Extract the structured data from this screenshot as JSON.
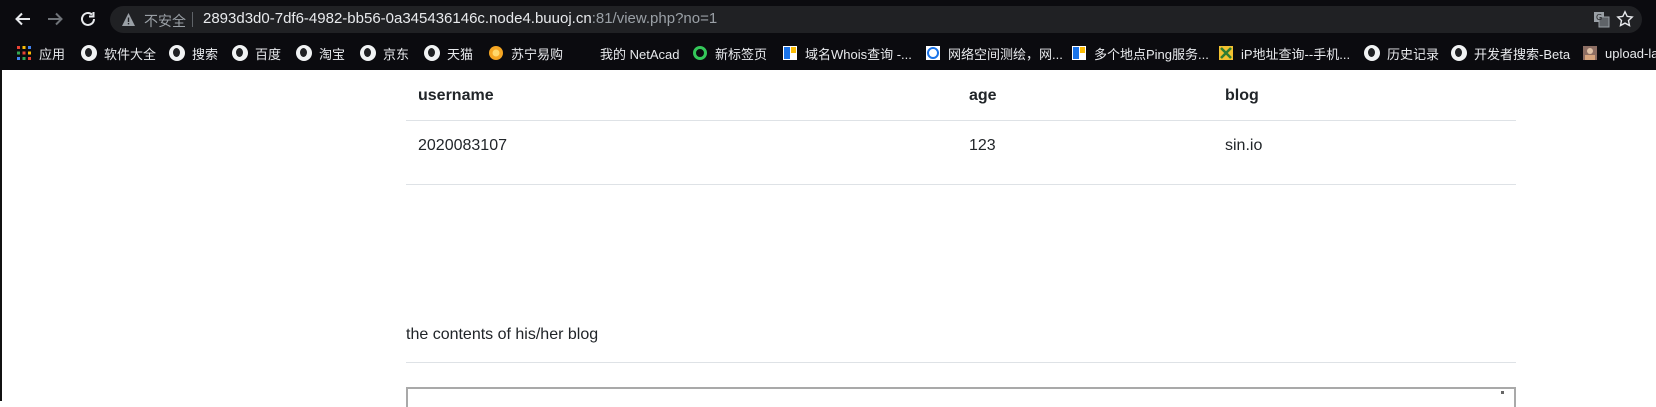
{
  "browser": {
    "security_label": "不安全",
    "url_host": "2893d3d0-7df6-4982-bb56-0a345436146c.node4.buuoj.cn",
    "url_path": ":81/view.php?no=1",
    "bookmarks": [
      {
        "label": "应用",
        "icon": "apps-grid-icon"
      },
      {
        "label": "软件大全",
        "icon": "globe-icon"
      },
      {
        "label": "搜索",
        "icon": "globe-icon"
      },
      {
        "label": "百度",
        "icon": "globe-icon"
      },
      {
        "label": "淘宝",
        "icon": "globe-icon"
      },
      {
        "label": "京东",
        "icon": "globe-icon"
      },
      {
        "label": "天猫",
        "icon": "globe-icon"
      },
      {
        "label": "苏宁易购",
        "icon": "suning-icon"
      },
      {
        "label": "我的 NetAcad",
        "icon": "netacad-icon"
      },
      {
        "label": "新标签页",
        "icon": "green-ring-icon"
      },
      {
        "label": "域名Whois查询 -...",
        "icon": "bookmark-blue-icon"
      },
      {
        "label": "网络空间测绘，网...",
        "icon": "shield-blue-icon"
      },
      {
        "label": "多个地点Ping服务...",
        "icon": "bookmark-blue-icon"
      },
      {
        "label": "iP地址查询--手机...",
        "icon": "ip-icon"
      },
      {
        "label": "历史记录",
        "icon": "globe-icon"
      },
      {
        "label": "开发者搜索-Beta",
        "icon": "globe-icon"
      },
      {
        "label": "upload-la",
        "icon": "avatar-icon"
      }
    ]
  },
  "table": {
    "headers": [
      "username",
      "age",
      "blog"
    ],
    "rows": [
      [
        "2020083107",
        "123",
        "sin.io"
      ]
    ]
  },
  "blog_section": {
    "title": "the contents of his/her blog"
  }
}
